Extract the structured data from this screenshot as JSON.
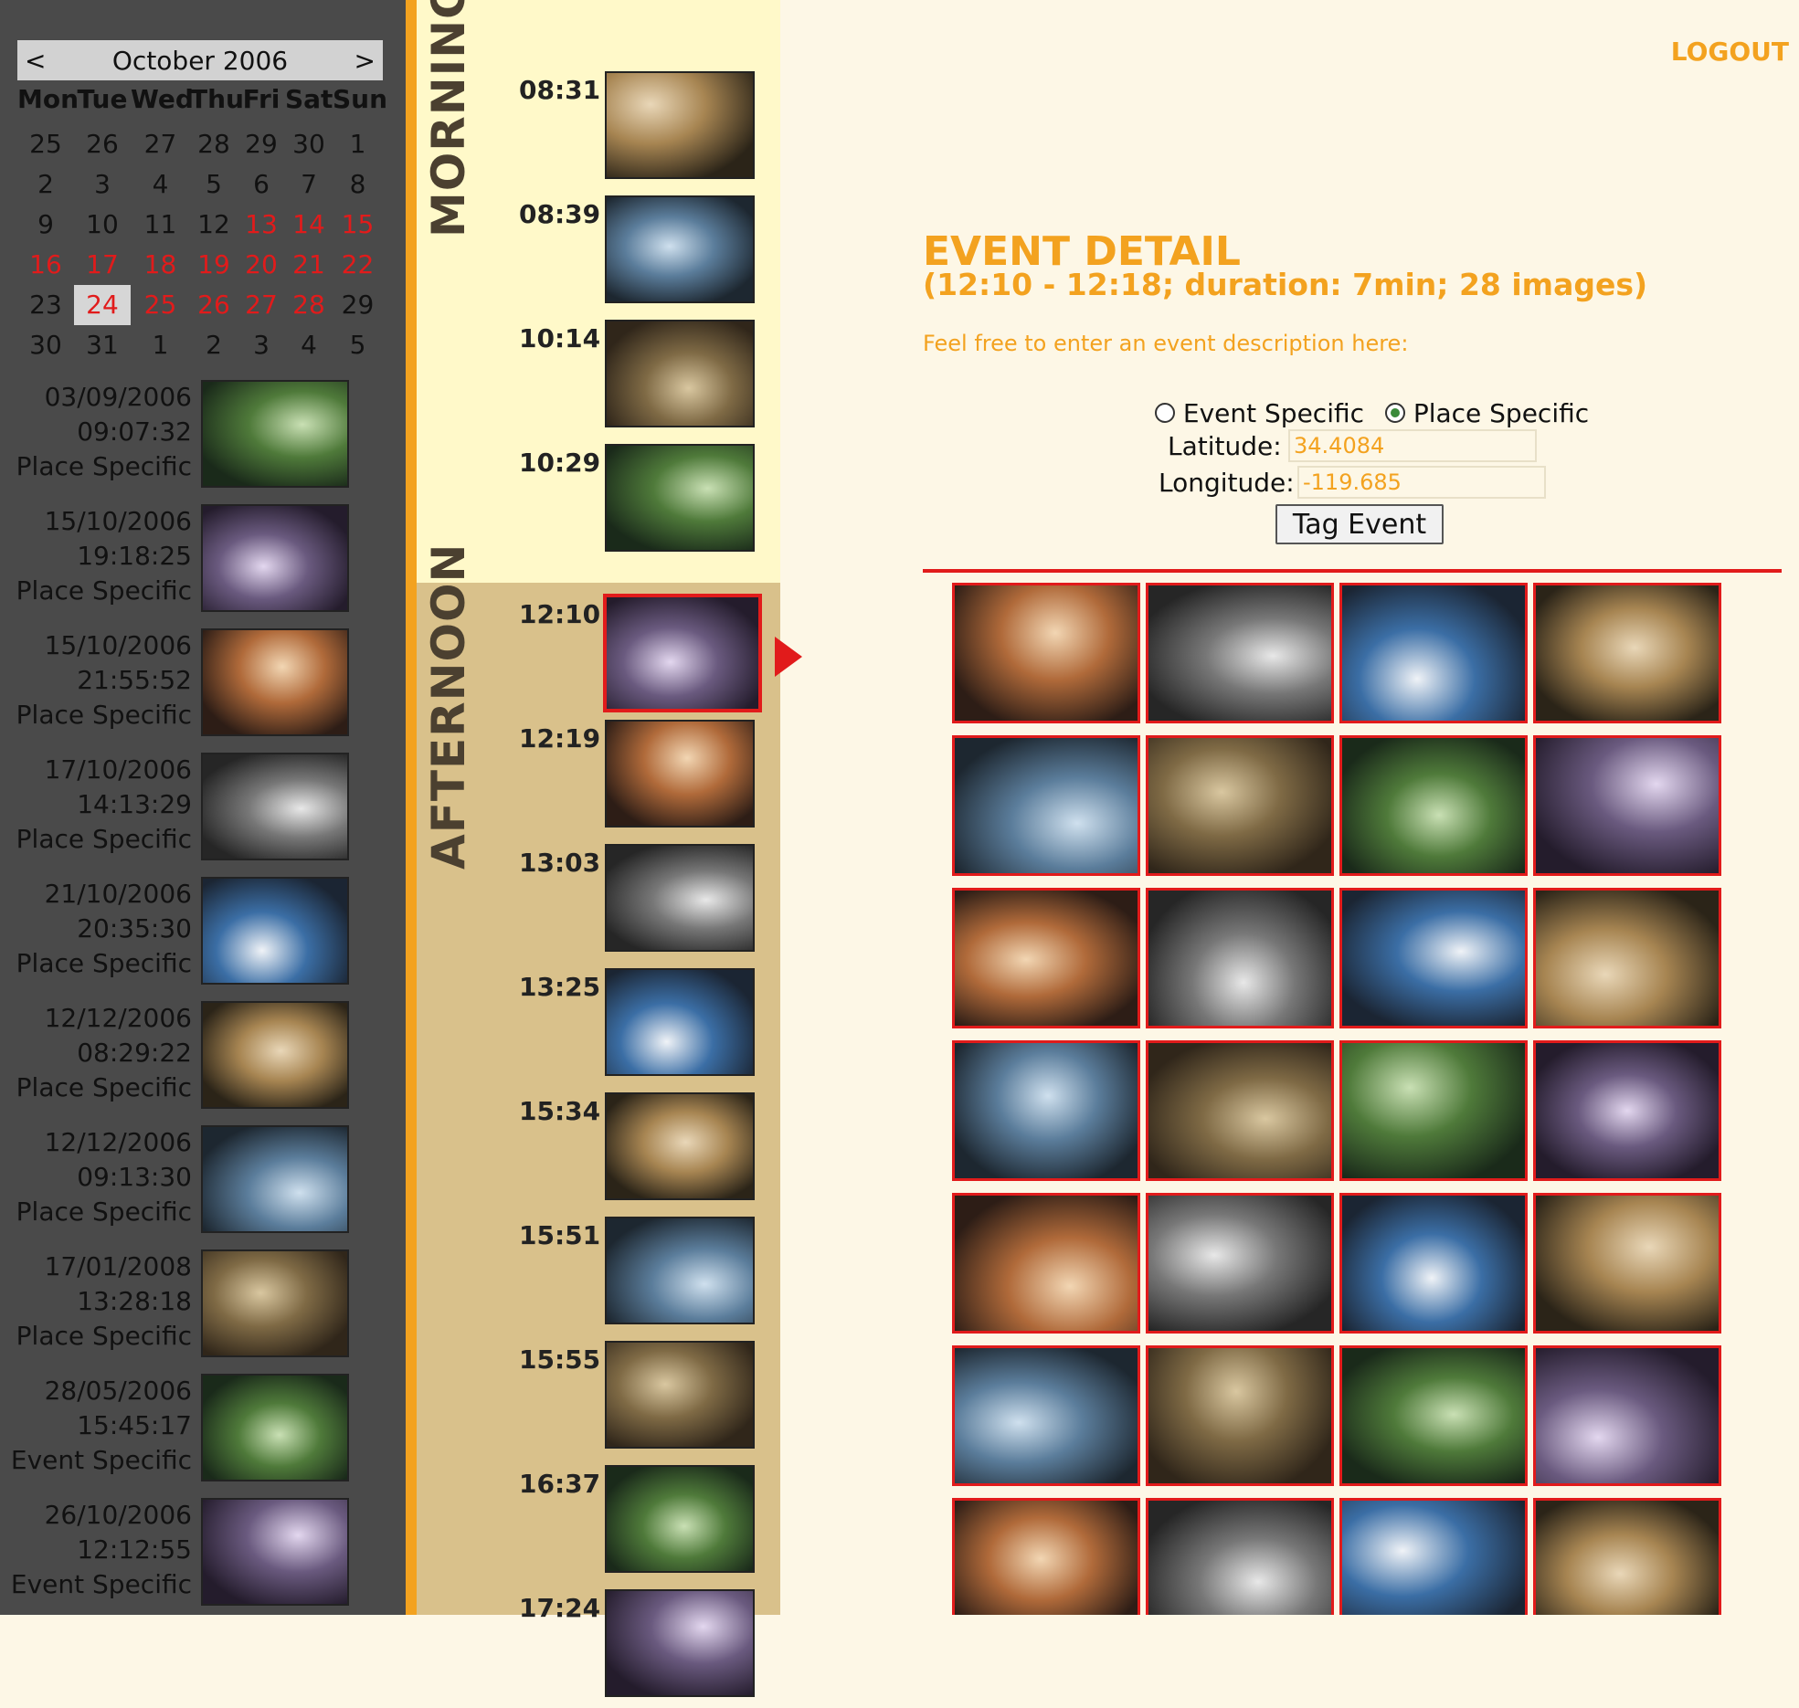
{
  "calendar": {
    "prev_label": "<",
    "next_label": ">",
    "month_label": "October 2006",
    "weekdays": [
      "Mon",
      "Tue",
      "Wed",
      "Thu",
      "Fri",
      "Sat",
      "Sun"
    ],
    "weeks": [
      [
        {
          "d": "25"
        },
        {
          "d": "26"
        },
        {
          "d": "27"
        },
        {
          "d": "28"
        },
        {
          "d": "29"
        },
        {
          "d": "30"
        },
        {
          "d": "1"
        }
      ],
      [
        {
          "d": "2"
        },
        {
          "d": "3"
        },
        {
          "d": "4"
        },
        {
          "d": "5"
        },
        {
          "d": "6"
        },
        {
          "d": "7"
        },
        {
          "d": "8"
        }
      ],
      [
        {
          "d": "9"
        },
        {
          "d": "10"
        },
        {
          "d": "11"
        },
        {
          "d": "12"
        },
        {
          "d": "13",
          "has": true
        },
        {
          "d": "14",
          "has": true
        },
        {
          "d": "15",
          "has": true
        }
      ],
      [
        {
          "d": "16",
          "has": true
        },
        {
          "d": "17",
          "has": true
        },
        {
          "d": "18",
          "has": true
        },
        {
          "d": "19",
          "has": true
        },
        {
          "d": "20",
          "has": true
        },
        {
          "d": "21",
          "has": true
        },
        {
          "d": "22",
          "has": true
        }
      ],
      [
        {
          "d": "23"
        },
        {
          "d": "24",
          "has": true,
          "sel": true
        },
        {
          "d": "25",
          "has": true
        },
        {
          "d": "26",
          "has": true
        },
        {
          "d": "27",
          "has": true
        },
        {
          "d": "28",
          "has": true
        },
        {
          "d": "29"
        }
      ],
      [
        {
          "d": "30"
        },
        {
          "d": "31"
        },
        {
          "d": "1"
        },
        {
          "d": "2"
        },
        {
          "d": "3"
        },
        {
          "d": "4"
        },
        {
          "d": "5"
        }
      ]
    ]
  },
  "tagged_events": [
    {
      "date": "03/09/2006",
      "time": "09:07:32",
      "type": "Place Specific"
    },
    {
      "date": "15/10/2006",
      "time": "19:18:25",
      "type": "Place Specific"
    },
    {
      "date": "15/10/2006",
      "time": "21:55:52",
      "type": "Place Specific"
    },
    {
      "date": "17/10/2006",
      "time": "14:13:29",
      "type": "Place Specific"
    },
    {
      "date": "21/10/2006",
      "time": "20:35:30",
      "type": "Place Specific"
    },
    {
      "date": "12/12/2006",
      "time": "08:29:22",
      "type": "Place Specific"
    },
    {
      "date": "12/12/2006",
      "time": "09:13:30",
      "type": "Place Specific"
    },
    {
      "date": "17/01/2008",
      "time": "13:28:18",
      "type": "Place Specific"
    },
    {
      "date": "28/05/2006",
      "time": "15:45:17",
      "type": "Event Specific"
    },
    {
      "date": "26/10/2006",
      "time": "12:12:55",
      "type": "Event Specific"
    }
  ],
  "timeline": {
    "morning_label": "MORNING",
    "afternoon_label": "AFTERNOON",
    "morning": [
      "08:31",
      "08:39",
      "10:14",
      "10:29"
    ],
    "afternoon": [
      "12:10",
      "12:19",
      "13:03",
      "13:25",
      "15:34",
      "15:51",
      "15:55",
      "16:37",
      "17:24"
    ],
    "active_time": "12:10"
  },
  "header": {
    "logout_label": "LOGOUT"
  },
  "event_detail": {
    "title": "EVENT DETAIL",
    "subtitle": "(12:10 - 12:18; duration: 7min; 28 images)",
    "description_prompt": "Feel free to enter an event description here:",
    "radio_event_label": "Event Specific",
    "radio_place_label": "Place Specific",
    "selected_type": "Place Specific",
    "latitude_label": "Latitude:",
    "latitude_value": "34.4084",
    "longitude_label": "Longitude:",
    "longitude_value": "-119.685",
    "tag_button_label": "Tag Event",
    "image_count": 28
  },
  "colors": {
    "accent": "#f3a21f",
    "highlight": "#e11b1b",
    "sidebar_bg": "#4a4a4a",
    "morning_bg": "#fff9c9",
    "afternoon_bg": "#d9c18b",
    "page_bg": "#fdf7e6"
  },
  "icons": {
    "active_marker": "triangle-right-icon"
  }
}
